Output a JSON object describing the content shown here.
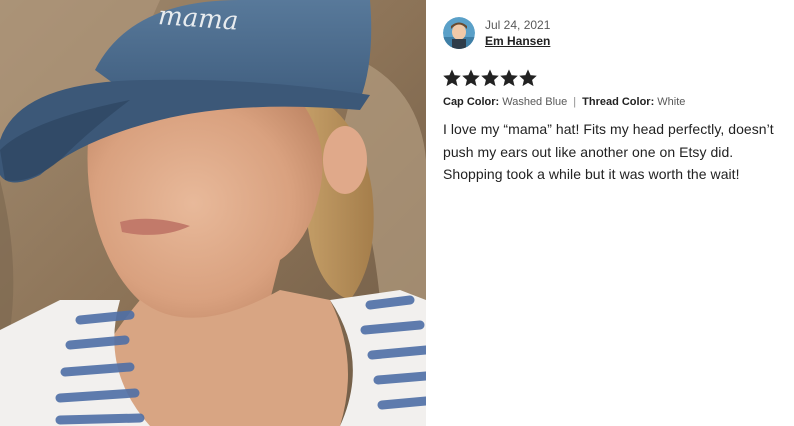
{
  "review": {
    "date": "Jul 24, 2021",
    "author": "Em Hansen",
    "rating": 5,
    "rating_max": 5,
    "variations": [
      {
        "label": "Cap Color:",
        "value": "Washed Blue"
      },
      {
        "label": "Thread Color:",
        "value": "White"
      }
    ],
    "separator": "|",
    "text": "I love my “mama” hat! Fits my head perfectly, doesn’t push my ears out like another one on Etsy did. Shopping took a while but it was worth the wait!"
  },
  "photo": {
    "hat_embroidery": "mama"
  },
  "colors": {
    "star": "#222222",
    "hat": "#4b6b8c",
    "text": "#222222",
    "muted": "#595959"
  },
  "icons": {
    "avatar": "user-avatar",
    "star": "star-icon"
  }
}
